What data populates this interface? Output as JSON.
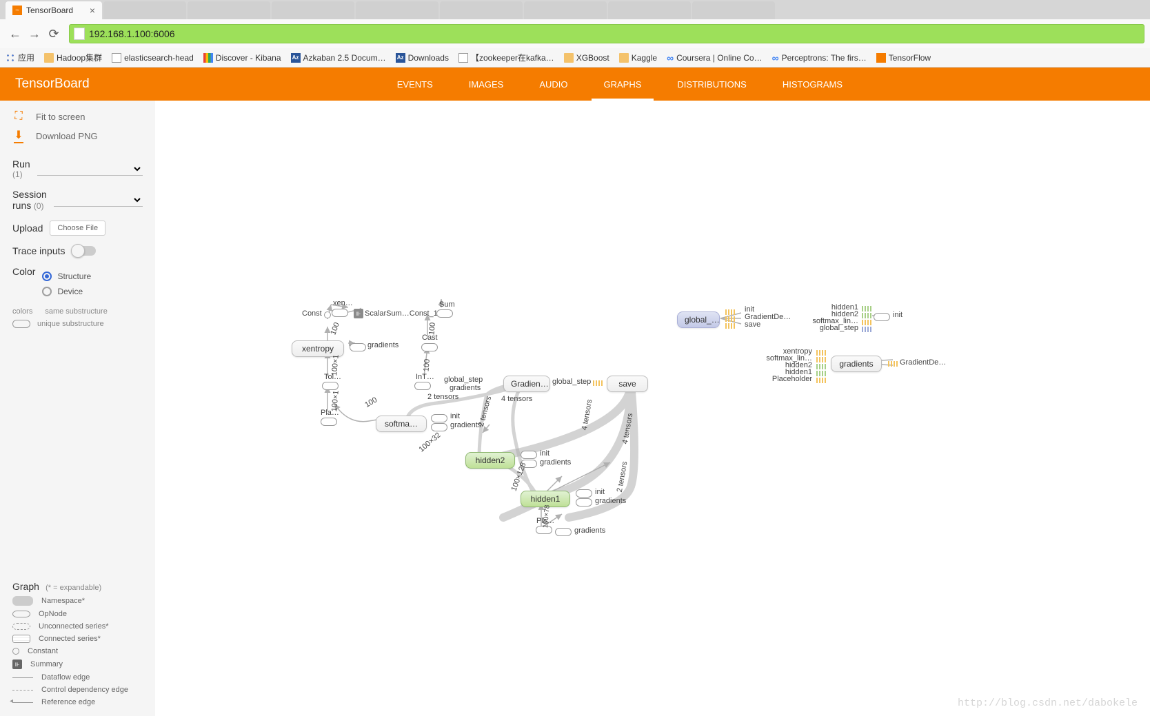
{
  "browser": {
    "tab_title": "TensorBoard",
    "url": "192.168.1.100:6006",
    "url_port": ":6006"
  },
  "bookmarks": {
    "apps": "应用",
    "hadoop": "Hadoop集群",
    "elastic": "elasticsearch-head",
    "kibana": "Discover - Kibana",
    "azkaban": "Azkaban 2.5 Docum…",
    "downloads": "Downloads",
    "zookeeper": "【zookeeper在kafka…",
    "xgboost": "XGBoost",
    "kaggle": "Kaggle",
    "coursera": "Coursera | Online Co…",
    "perceptrons": "Perceptrons: The firs…",
    "tensorflow": "TensorFlow"
  },
  "header": {
    "logo": "TensorBoard",
    "nav": {
      "events": "EVENTS",
      "images": "IMAGES",
      "audio": "AUDIO",
      "graphs": "GRAPHS",
      "distributions": "DISTRIBUTIONS",
      "histograms": "HISTOGRAMS"
    }
  },
  "sidebar": {
    "fit": "Fit to screen",
    "download": "Download PNG",
    "run_label": "Run",
    "run_count": "(1)",
    "session_label": "Session",
    "session_runs": "runs",
    "session_count": "(0)",
    "upload_label": "Upload",
    "choose_file": "Choose File",
    "trace_label": "Trace inputs",
    "color_label": "Color",
    "color_structure": "Structure",
    "color_device": "Device",
    "colors_head": "colors",
    "same_sub": "same substructure",
    "unique_sub": "unique substructure",
    "graph_head": "Graph",
    "expandable_hint": "(* = expandable)",
    "legend": {
      "namespace": "Namespace*",
      "opnode": "OpNode",
      "unconnected": "Unconnected series*",
      "connected": "Connected series*",
      "constant": "Constant",
      "summary": "Summary",
      "dataflow": "Dataflow edge",
      "controldep": "Control dependency edge",
      "reference": "Reference edge"
    }
  },
  "graph": {
    "const": "Const",
    "xen": "xen…",
    "sum": "Sum",
    "scalar": "ScalarSum…Const_1",
    "xentropy": "xentropy",
    "gradients_lbl": "gradients",
    "cast": "Cast",
    "tol": "Tol…",
    "int": "InT…",
    "pla": "Pla…",
    "softma": "softma…",
    "gradien": "Gradien…",
    "global_step": "global_step",
    "save": "save",
    "hidden2": "hidden2",
    "hidden1": "hidden1",
    "pls": "Pls…",
    "init": "init",
    "gradientde": "GradientDe…",
    "global_short": "global_…",
    "hidden1_lbl": "hidden1",
    "hidden2_lbl": "hidden2",
    "softmax_lin": "softmax_lin…",
    "placeholder": "Placeholder",
    "two_tensors": "2 tensors",
    "four_tensors": "4 tensors",
    "n100": "100",
    "n100x1": "100×1",
    "n100x32": "100×32",
    "n100x128": "100×128",
    "n100x78": "100×78"
  },
  "watermark": "http://blog.csdn.net/dabokele"
}
